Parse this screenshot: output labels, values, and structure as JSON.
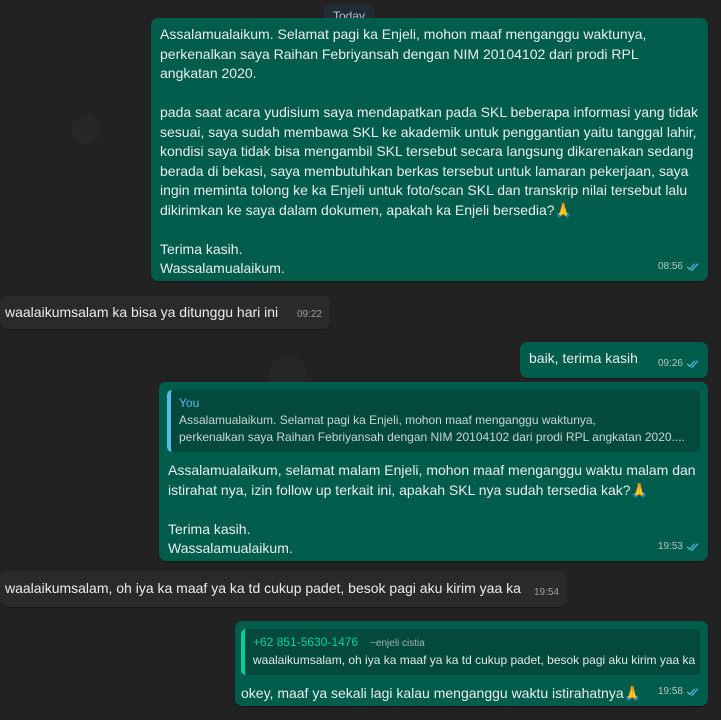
{
  "date_label": "Today",
  "messages": [
    {
      "text": "Assalamualaikum. Selamat pagi ka Enjeli, mohon maaf menganggu waktunya, perkenalkan saya Raihan Febriyansah dengan NIM 20104102 dari prodi RPL angkatan 2020.\n\npada saat acara yudisium saya mendapatkan pada SKL beberapa informasi yang tidak sesuai, saya sudah membawa SKL ke akademik untuk penggantian yaitu tanggal lahir, kondisi saya tidak bisa mengambil SKL tersebut secara langsung dikarenakan sedang berada di bekasi, saya membutuhkan berkas tersebut untuk lamaran pekerjaan, saya ingin meminta tolong ke ka Enjeli untuk foto/scan SKL dan transkrip nilai tersebut lalu dikirimkan ke saya dalam dokumen, apakah ka Enjeli bersedia?🙏\n\nTerima kasih.\nWassalamualaikum.",
      "time": "08:56"
    },
    {
      "text": "waalaikumsalam ka bisa ya ditunggu hari ini",
      "time": "09:22"
    },
    {
      "text": "baik, terima kasih",
      "time": "09:26"
    },
    {
      "quote_author": "You",
      "quote_text": "Assalamualaikum. Selamat pagi ka Enjeli, mohon maaf menganggu waktunya,\nperkenalkan saya Raihan Febriyansah dengan NIM 20104102 dari prodi RPL angkatan 2020....",
      "text": "Assalamualaikum, selamat malam Enjeli, mohon maaf menganggu waktu malam dan istirahat nya, izin follow up terkait ini, apakah SKL nya sudah tersedia kak?🙏\n\nTerima kasih.\nWassalamualaikum.",
      "time": "19:53"
    },
    {
      "text": "waalaikumsalam, oh iya ka maaf ya ka td cukup padet, besok pagi aku kirim yaa ka",
      "time": "19:54"
    },
    {
      "quote_phone": "+62 851-5630-1476",
      "quote_name": "~enjeli cistia",
      "quote_text": "waalaikumsalam, oh iya ka maaf ya ka td cukup padet, besok pagi aku kirim yaa ka",
      "text": "okey, maaf ya sekali lagi kalau menganggu waktu istirahatnya🙏",
      "time": "19:58"
    }
  ],
  "colors": {
    "outgoing_bubble": "#005c4b",
    "incoming_bubble": "#2a2a2a",
    "read_ticks": "#53bdeb",
    "quote_you_bar": "#53bdeb",
    "quote_contact_bar": "#06cf9c"
  },
  "icons": {
    "read_receipt": "double-check-icon"
  }
}
